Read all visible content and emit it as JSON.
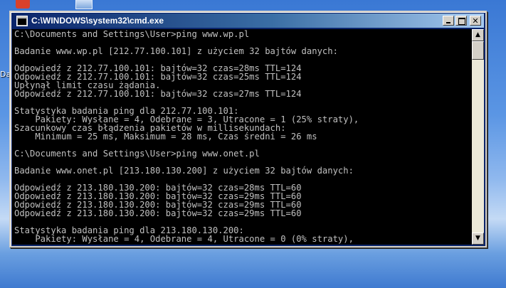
{
  "window": {
    "title": "C:\\WINDOWS\\system32\\cmd.exe",
    "minimize_glyph": "",
    "maximize_glyph": "",
    "close_glyph": "✕"
  },
  "desktop": {
    "partial_label": "Da"
  },
  "console": {
    "lines": [
      "C:\\Documents and Settings\\User>ping www.wp.pl",
      "",
      "Badanie www.wp.pl [212.77.100.101] z użyciem 32 bajtów danych:",
      "",
      "Odpowiedź z 212.77.100.101: bajtów=32 czas=28ms TTL=124",
      "Odpowiedź z 212.77.100.101: bajtów=32 czas=25ms TTL=124",
      "Upłynął limit czasu żądania.",
      "Odpowiedź z 212.77.100.101: bajtów=32 czas=27ms TTL=124",
      "",
      "Statystyka badania ping dla 212.77.100.101:",
      "    Pakiety: Wysłane = 4, Odebrane = 3, Utracone = 1 (25% straty),",
      "Szacunkowy czas błądzenia pakietów w millisekundach:",
      "    Minimum = 25 ms, Maksimum = 28 ms, Czas średni = 26 ms",
      "",
      "C:\\Documents and Settings\\User>ping www.onet.pl",
      "",
      "Badanie www.onet.pl [213.180.130.200] z użyciem 32 bajtów danych:",
      "",
      "Odpowiedź z 213.180.130.200: bajtów=32 czas=28ms TTL=60",
      "Odpowiedź z 213.180.130.200: bajtów=32 czas=29ms TTL=60",
      "Odpowiedź z 213.180.130.200: bajtów=32 czas=29ms TTL=60",
      "Odpowiedź z 213.180.130.200: bajtów=32 czas=29ms TTL=60",
      "",
      "Statystyka badania ping dla 213.180.130.200:",
      "    Pakiety: Wysłane = 4, Odebrane = 4, Utracone = 0 (0% straty),"
    ]
  },
  "scrollbar": {
    "up_arrow": "▲",
    "down_arrow": "▼"
  },
  "colors": {
    "console_bg": "#000000",
    "console_text": "#c0c0c0",
    "titlebar_start": "#0a246a",
    "titlebar_end": "#a6caf0"
  }
}
